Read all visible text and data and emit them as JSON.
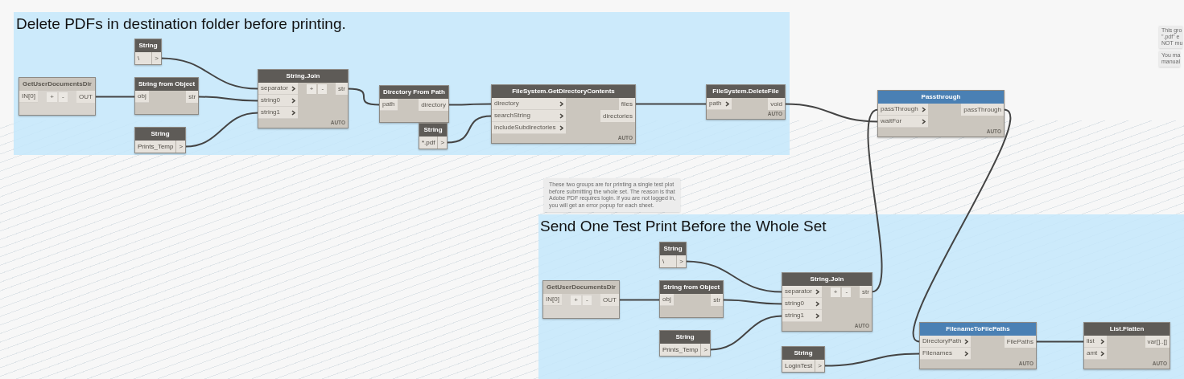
{
  "groups": [
    {
      "title": "Delete PDFs in destination folder before printing."
    },
    {
      "title": "Send One Test Print Before the Whole Set"
    }
  ],
  "notes": [
    {
      "lines": [
        "These two groups are for printing a single test plot",
        "before submitting the whole set. The reason is that",
        "Adobe PDF requires login. If you are not logged in,",
        "you will get an error popup for each sheet."
      ]
    },
    {
      "lines": [
        "This gro",
        "\".pdf\" e",
        "NOT mu"
      ]
    },
    {
      "lines": [
        "You ma",
        "manual"
      ]
    }
  ],
  "nodes": [
    {
      "title": "String",
      "kind": "string",
      "value": "\\",
      "outputs": [
        ">"
      ]
    },
    {
      "title": "GetUserDocumentsDir",
      "kind": "script",
      "inputs": [
        {
          "label": "IN[0]",
          "chevron": false
        }
      ],
      "add_remove": [
        "+",
        "-"
      ],
      "outputs": [
        "OUT"
      ]
    },
    {
      "title": "String from Object",
      "kind": "function",
      "inputs": [
        {
          "label": "obj",
          "chevron": false
        }
      ],
      "outputs": [
        "str"
      ]
    },
    {
      "title": "String",
      "kind": "string",
      "value": "Prints_Temp",
      "outputs": [
        ">"
      ]
    },
    {
      "title": "String.Join",
      "kind": "function",
      "inputs": [
        {
          "label": "separator",
          "chevron": true
        },
        {
          "label": "string0",
          "chevron": true
        },
        {
          "label": "string1",
          "chevron": true
        }
      ],
      "add_remove": [
        "+",
        "-"
      ],
      "outputs": [
        "str"
      ],
      "lacing": "AUTO"
    },
    {
      "title": "Directory From Path",
      "kind": "function",
      "inputs": [
        {
          "label": "path",
          "chevron": false
        }
      ],
      "outputs": [
        "directory"
      ]
    },
    {
      "title": "String",
      "kind": "string",
      "value": "*.pdf",
      "outputs": [
        ">"
      ]
    },
    {
      "title": "FileSystem.GetDirectoryContents",
      "kind": "function",
      "inputs": [
        {
          "label": "directory",
          "chevron": true
        },
        {
          "label": "searchString",
          "chevron": true
        },
        {
          "label": "includeSubdirectories",
          "chevron": true
        }
      ],
      "outputs": [
        "files",
        "directories"
      ],
      "lacing": "AUTO"
    },
    {
      "title": "FileSystem.DeleteFile",
      "kind": "function",
      "inputs": [
        {
          "label": "path",
          "chevron": true
        }
      ],
      "outputs": [
        "void"
      ],
      "lacing": "AUTO"
    },
    {
      "title": "Passthrough",
      "kind": "custom",
      "inputs": [
        {
          "label": "passThrough",
          "chevron": true
        },
        {
          "label": "waitFor",
          "chevron": true
        }
      ],
      "outputs": [
        "passThrough"
      ],
      "lacing": "AUTO"
    },
    {
      "title": "GetUserDocumentsDir",
      "kind": "script",
      "inputs": [
        {
          "label": "IN[0]",
          "chevron": false
        }
      ],
      "add_remove": [
        "+",
        "-"
      ],
      "outputs": [
        "OUT"
      ]
    },
    {
      "title": "String",
      "kind": "string",
      "value": "\\",
      "outputs": [
        ">"
      ]
    },
    {
      "title": "String from Object",
      "kind": "function",
      "inputs": [
        {
          "label": "obj",
          "chevron": false
        }
      ],
      "outputs": [
        "str"
      ]
    },
    {
      "title": "String",
      "kind": "string",
      "value": "Prints_Temp",
      "outputs": [
        ">"
      ]
    },
    {
      "title": "String.Join",
      "kind": "function",
      "inputs": [
        {
          "label": "separator",
          "chevron": true
        },
        {
          "label": "string0",
          "chevron": true
        },
        {
          "label": "string1",
          "chevron": true
        }
      ],
      "add_remove": [
        "+",
        "-"
      ],
      "outputs": [
        "str"
      ],
      "lacing": "AUTO"
    },
    {
      "title": "String",
      "kind": "string",
      "value": "LoginTest",
      "outputs": [
        ">"
      ]
    },
    {
      "title": "FilenameToFilePaths",
      "kind": "custom",
      "inputs": [
        {
          "label": "DirectoryPath",
          "chevron": true
        },
        {
          "label": "Filenames",
          "chevron": true
        }
      ],
      "outputs": [
        "FilePaths"
      ],
      "lacing": "AUTO"
    },
    {
      "title": "List.Flatten",
      "kind": "function",
      "inputs": [
        {
          "label": "list",
          "chevron": true
        },
        {
          "label": "amt",
          "chevron": true
        }
      ],
      "outputs": [
        "var[]..[]"
      ],
      "lacing": "AUTO"
    }
  ]
}
